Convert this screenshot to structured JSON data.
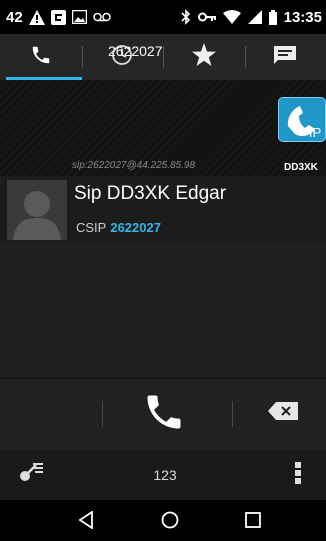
{
  "status_bar": {
    "notification_count": "42",
    "time": "13:35",
    "icons": [
      "warning-icon",
      "app-notification-icon",
      "image-icon",
      "voicemail-icon",
      "bluetooth-icon",
      "vpn-key-icon",
      "wifi-icon",
      "signal-icon",
      "battery-icon"
    ]
  },
  "tabs": [
    {
      "icon": "phone-icon",
      "active": true
    },
    {
      "icon": "clock-icon",
      "active": false
    },
    {
      "icon": "star-icon",
      "active": false
    },
    {
      "icon": "message-icon",
      "active": false
    }
  ],
  "dialer": {
    "number": "2622027",
    "sip_address": "sip:2622027@44.225.85.98",
    "account_short": "DD3XK",
    "ip_badge": "IP"
  },
  "suggestion": {
    "name": "Sip DD3XK Edgar",
    "type_label": "CSIP",
    "number": "2622027"
  },
  "toolbar": {
    "dialpad_label": "123"
  },
  "colors": {
    "accent": "#33b5e5",
    "ip_button": "#2196c9"
  }
}
